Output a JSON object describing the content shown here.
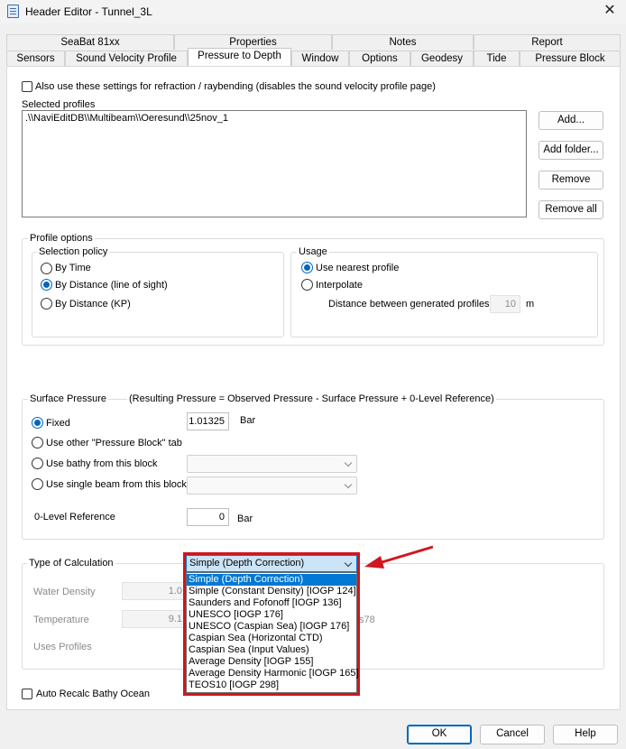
{
  "window": {
    "title": "Header Editor - Tunnel_3L",
    "close_icon": "close-icon"
  },
  "tabs_row1": [
    "SeaBat 81xx",
    "Properties",
    "Notes",
    "Report"
  ],
  "tabs_row2": [
    "Sensors",
    "Sound Velocity Profile",
    "Pressure to Depth",
    "Window",
    "Options",
    "Geodesy",
    "Tide",
    "Pressure Block"
  ],
  "active_tab": "Pressure to Depth",
  "refraction_checkbox": {
    "label": "Also use these settings for refraction / raybending (disables the sound velocity profile page)",
    "checked": false
  },
  "selected_profiles": {
    "label": "Selected profiles",
    "items": [
      ".\\\\NaviEditDB\\\\Multibeam\\\\Oeresund\\\\25nov_1"
    ],
    "buttons": [
      "Add...",
      "Add folder...",
      "Remove",
      "Remove all"
    ]
  },
  "profile_options": {
    "title": "Profile options",
    "selection_policy": {
      "title": "Selection policy",
      "options": [
        "By Time",
        "By Distance (line of sight)",
        "By Distance (KP)"
      ],
      "selected": "By Distance (line of sight)"
    },
    "usage": {
      "title": "Usage",
      "options": [
        "Use nearest profile",
        "Interpolate"
      ],
      "selected": "Use nearest profile",
      "distance_label": "Distance between generated profiles",
      "distance_value": "10",
      "distance_unit": "m"
    }
  },
  "surface_pressure": {
    "title": "Surface Pressure",
    "formula": "(Resulting Pressure = Observed Pressure - Surface Pressure + 0-Level Reference)",
    "options": [
      "Fixed",
      "Use other \"Pressure Block\" tab",
      "Use bathy from this block",
      "Use single beam from this block"
    ],
    "selected": "Fixed",
    "fixed_value": "1.01325",
    "fixed_unit": "Bar",
    "zero_level_label": "0-Level Reference",
    "zero_level_value": "0",
    "zero_level_unit": "Bar"
  },
  "calculation": {
    "title": "Type of Calculation",
    "selected": "Simple (Depth Correction)",
    "options": [
      "Simple (Depth Correction)",
      "Simple (Constant Density) [IOGP 124]",
      "Saunders and Fofonoff [IOGP 136]",
      "UNESCO [IOGP 176]",
      "UNESCO (Caspian Sea) [IOGP 176]",
      "Caspian Sea (Horizontal CTD)",
      "Caspian Sea (Input Values)",
      "Average Density [IOGP 155]",
      "Average Density Harmonic [IOGP 165]",
      "TEOS10 [IOGP 298]"
    ],
    "water_density_label": "Water Density",
    "water_density_value": "1.0",
    "temperature_label": "Temperature",
    "temperature_value": "9.1",
    "temperature_suffix": "s78",
    "uses_profiles_label": "Uses Profiles"
  },
  "auto_recalc": {
    "label": "Auto Recalc Bathy Ocean",
    "checked": false
  },
  "footer_buttons": {
    "ok": "OK",
    "cancel": "Cancel",
    "help": "Help"
  },
  "annotation": {
    "highlight_color": "#d0161e",
    "arrow_icon": "red-arrow-icon"
  }
}
